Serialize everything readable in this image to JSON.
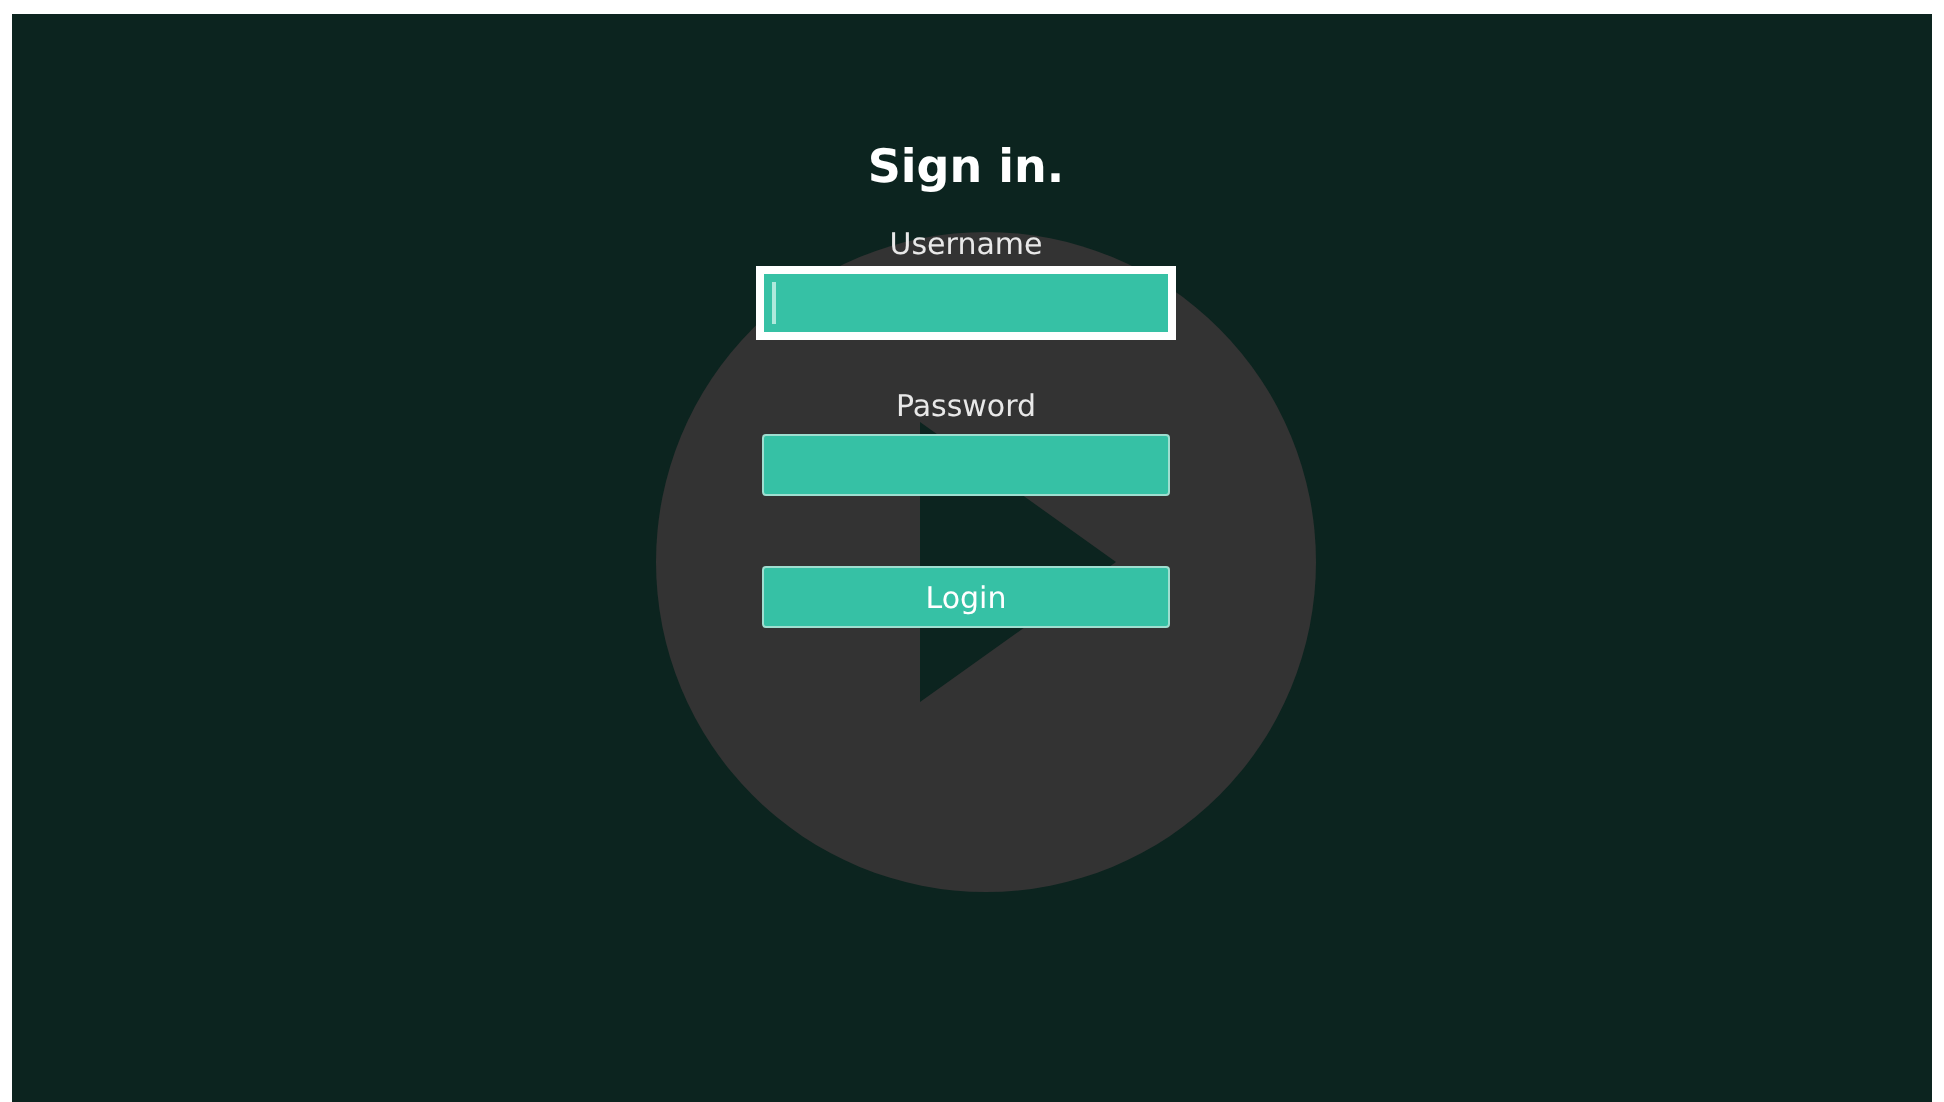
{
  "title": "Sign in.",
  "fields": [
    {
      "label": "Username",
      "focused": true
    },
    {
      "label": "Password",
      "focused": false
    }
  ],
  "login_button": {
    "label": "Login"
  }
}
